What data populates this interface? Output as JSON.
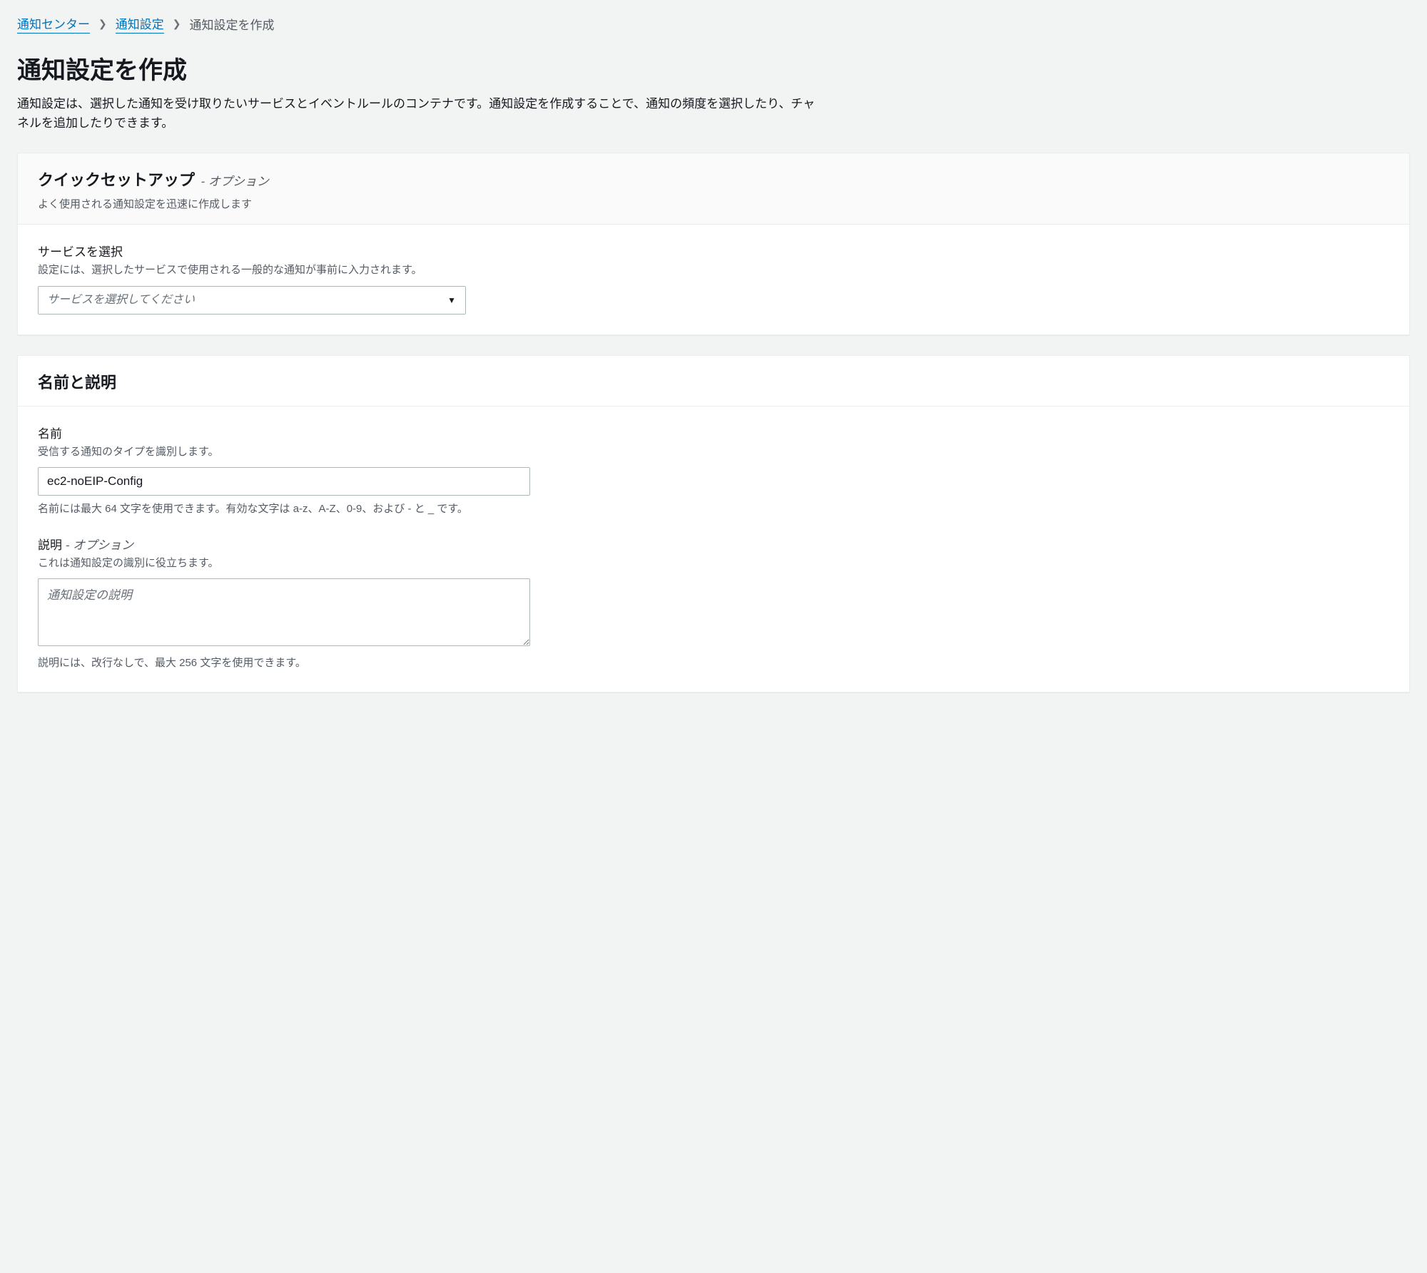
{
  "breadcrumb": {
    "items": [
      {
        "label": "通知センター"
      },
      {
        "label": "通知設定"
      }
    ],
    "current": "通知設定を作成"
  },
  "page": {
    "title": "通知設定を作成",
    "description": "通知設定は、選択した通知を受け取りたいサービスとイベントルールのコンテナです。通知設定を作成することで、通知の頻度を選択したり、チャネルを追加したりできます。"
  },
  "quickSetup": {
    "title": "クイックセットアップ",
    "subtitle": "- オプション",
    "help": "よく使用される通知設定を迅速に作成します",
    "serviceSelect": {
      "label": "サービスを選択",
      "description": "設定には、選択したサービスで使用される一般的な通知が事前に入力されます。",
      "placeholder": "サービスを選択してください"
    }
  },
  "nameDesc": {
    "title": "名前と説明",
    "name": {
      "label": "名前",
      "description": "受信する通知のタイプを識別します。",
      "value": "ec2-noEIP-Config",
      "constraint": "名前には最大 64 文字を使用できます。有効な文字は a-z、A-Z、0-9、および - と _ です。"
    },
    "description": {
      "label": "説明",
      "optional": " - オプション",
      "help": "これは通知設定の識別に役立ちます。",
      "placeholder": "通知設定の説明",
      "constraint": "説明には、改行なしで、最大 256 文字を使用できます。"
    }
  }
}
